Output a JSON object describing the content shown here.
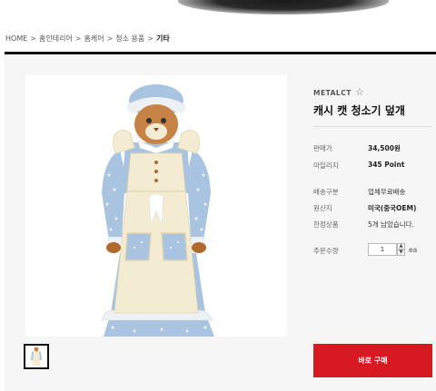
{
  "breadcrumb": {
    "items": [
      "HOME",
      "홈인테리어",
      "홈케어",
      "청소 용품",
      "기타"
    ],
    "separator": ">"
  },
  "product": {
    "brand": "METALCT",
    "title": "캐시 캣 청소기 덮개",
    "image_alt_icon": "cat-maid-doll-vacuum-cover",
    "info": [
      {
        "label": "판매가",
        "value": "34,500원"
      },
      {
        "label": "마일리지",
        "value": "345 Point"
      },
      {
        "label": "배송구분",
        "value": "업체무료배송"
      },
      {
        "label": "원산지",
        "value": "미국(중국OEM)"
      },
      {
        "label": "한정상품",
        "value": "5개 남았습니다."
      }
    ],
    "quantity_label": "주문수량",
    "quantity_value": "1",
    "quantity_unit": "ea",
    "buy_label": "바로 구매"
  },
  "colors": {
    "buy_button": "#d71921",
    "rule": "#111111"
  },
  "icons": {
    "favorite": "star-outline-icon",
    "qty_up": "triangle-up-icon",
    "qty_down": "triangle-down-icon"
  }
}
